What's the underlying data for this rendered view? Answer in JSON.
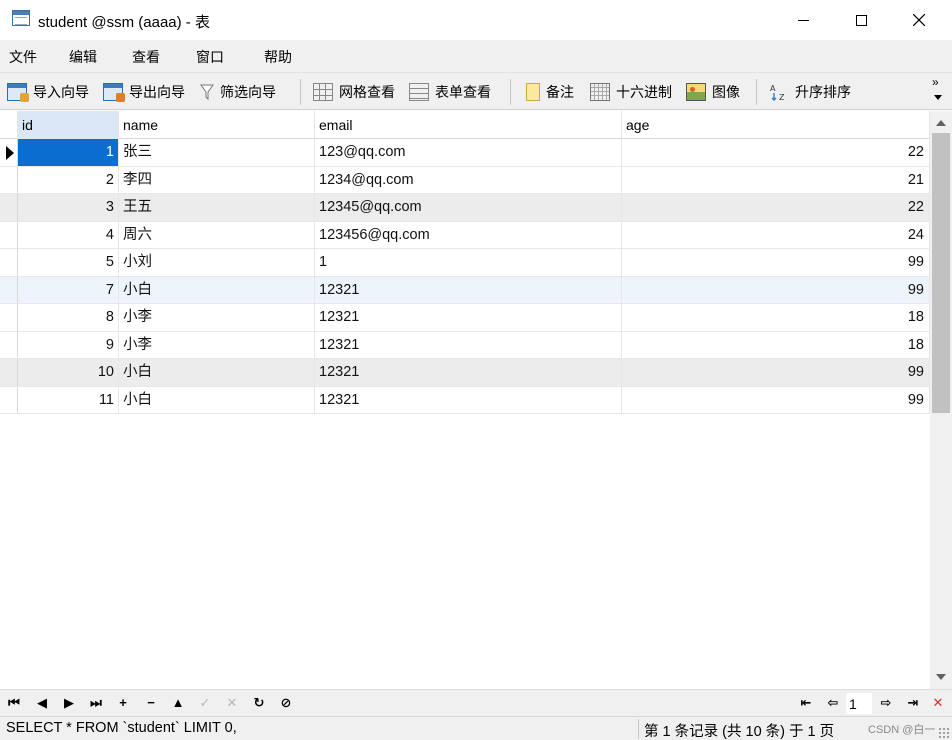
{
  "window": {
    "title": "student @ssm (aaaa) - 表",
    "controls": {
      "minimize": "—",
      "maximize": "☐",
      "close": "✕"
    }
  },
  "menu": [
    {
      "label": "文件"
    },
    {
      "label": "编辑"
    },
    {
      "label": "查看"
    },
    {
      "label": "窗口"
    },
    {
      "label": "帮助"
    }
  ],
  "toolbar": {
    "import_wizard": "导入向导",
    "export_wizard": "导出向导",
    "filter_wizard": "筛选向导",
    "grid_view": "网格查看",
    "form_view": "表单查看",
    "memo": "备注",
    "hex": "十六进制",
    "image": "图像",
    "sort_asc": "升序排序",
    "more": "»",
    "icons": [
      "import-icon",
      "export-icon",
      "filter-icon",
      "grid-icon",
      "form-icon",
      "memo-icon",
      "hex-icon",
      "image-icon",
      "sort-ascending-icon"
    ]
  },
  "table": {
    "columns": [
      "id",
      "name",
      "email",
      "age"
    ],
    "active_column": "id",
    "selected_row": 0,
    "rows": [
      {
        "id": "1",
        "name": "张三",
        "email": "123@qq.com",
        "age": "22"
      },
      {
        "id": "2",
        "name": "李四",
        "email": "1234@qq.com",
        "age": "21"
      },
      {
        "id": "3",
        "name": "王五",
        "email": "12345@qq.com",
        "age": "22"
      },
      {
        "id": "4",
        "name": "周六",
        "email": "123456@qq.com",
        "age": "24"
      },
      {
        "id": "5",
        "name": "小刘",
        "email": "1",
        "age": "99"
      },
      {
        "id": "7",
        "name": "小白",
        "email": "12321",
        "age": "99"
      },
      {
        "id": "8",
        "name": "小李",
        "email": "12321",
        "age": "18"
      },
      {
        "id": "9",
        "name": "小李",
        "email": "12321",
        "age": "18"
      },
      {
        "id": "10",
        "name": "小白",
        "email": "12321",
        "age": "99"
      },
      {
        "id": "11",
        "name": "小白",
        "email": "12321",
        "age": "99"
      }
    ]
  },
  "navigation": {
    "first": "⏮",
    "prev": "◀",
    "next": "▶",
    "last": "⏭",
    "add": "+",
    "delete": "−",
    "post": "▲",
    "check": "✓",
    "cancel": "✕",
    "refresh": "↻",
    "stop": "⊘",
    "page_first": "⇤",
    "page_prev": "⇦",
    "page_value": "1",
    "page_next": "⇨",
    "page_last": "⇥",
    "settings": "✕"
  },
  "status": {
    "sql": "SELECT * FROM `student` LIMIT 0,",
    "record_info": "第 1 条记录 (共 10 条) 于 1 页",
    "watermark": "CSDN @白一"
  },
  "colors": {
    "selection": "#0a6ed1",
    "active_header": "#dbe7f7",
    "alt_row": "#ececec",
    "chrome": "#f0f0f0"
  }
}
